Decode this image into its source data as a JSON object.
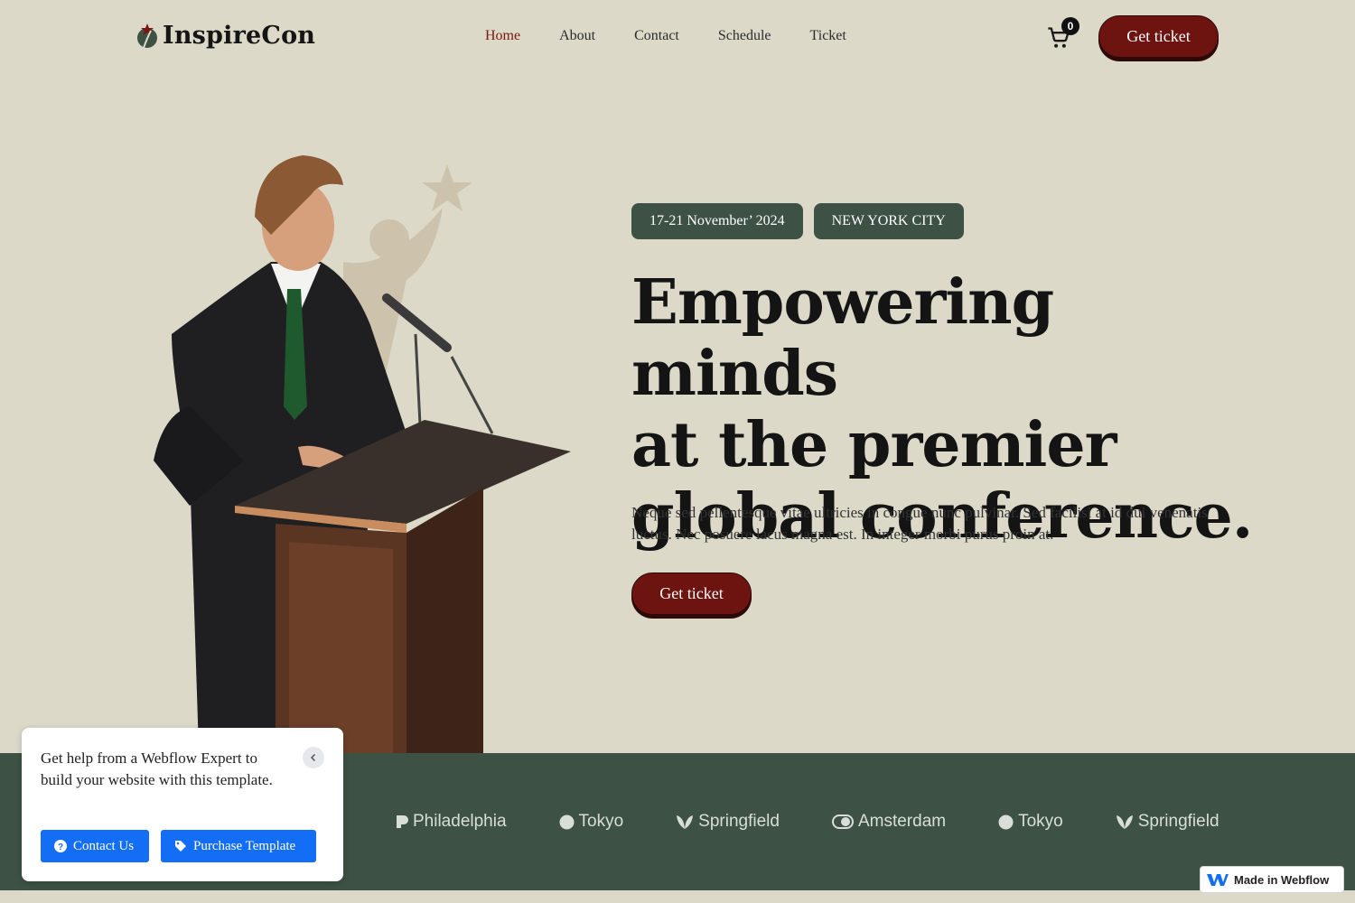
{
  "header": {
    "logo_text": "InspireCon",
    "nav": [
      {
        "label": "Home",
        "active": true
      },
      {
        "label": "About"
      },
      {
        "label": "Contact"
      },
      {
        "label": "Schedule"
      },
      {
        "label": "Ticket"
      }
    ],
    "cart_count": "0",
    "cta_label": "Get ticket"
  },
  "hero": {
    "tags": [
      "17-21 November’ 2024",
      "NEW YORK CITY"
    ],
    "headline_lines": [
      "Empowering minds",
      "at the premier",
      "global conference."
    ],
    "subtext": "Neque sed pellentesque vitae ultricies in congue nunc pulvinar. Sed facilisi at id dui venenatis luctus. Nec posuere lacus magna est. In integer morbi purus proin at.",
    "cta_label": "Get ticket"
  },
  "logos_band": {
    "cities": [
      "Philadelphia",
      "Tokyo",
      "Springfield",
      "Amsterdam",
      "Tokyo",
      "Springfield"
    ]
  },
  "help_popup": {
    "text": "Get help from a Webflow Expert to build your website with this template.",
    "contact_label": "Contact Us",
    "purchase_label": "Purchase Template"
  },
  "webflow_badge": {
    "label": "Made in Webflow"
  },
  "colors": {
    "background": "#dcd9c9",
    "accent_red": "#6e1410",
    "band_green": "#3d5244",
    "popup_blue": "#146ef5"
  },
  "icons": [
    "cart-icon",
    "question-icon",
    "tag-icon",
    "chevron-left-icon",
    "webflow-icon"
  ]
}
